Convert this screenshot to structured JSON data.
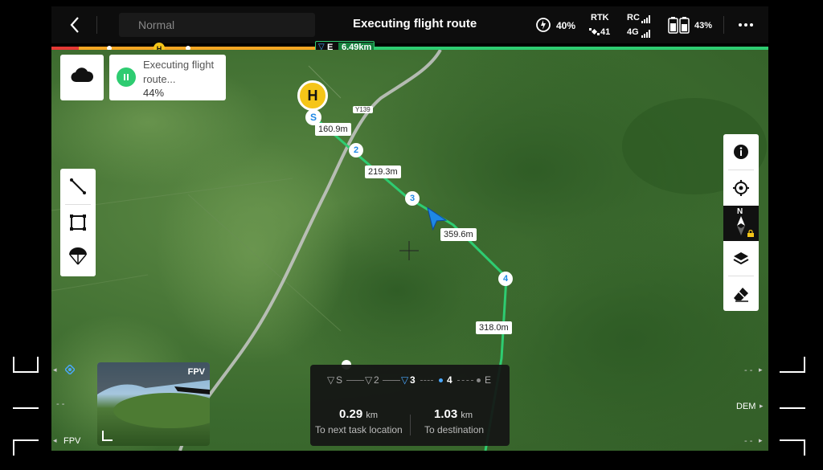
{
  "topbar": {
    "mode": "Normal",
    "title": "Executing flight route",
    "battery_drone": "40%",
    "rtk_label": "RTK",
    "rtk_sats": "41",
    "rc_label": "RC",
    "signal_4g": "4G",
    "battery_rc": "43%"
  },
  "progress": {
    "fraction": 0.37,
    "home_marker": "H",
    "end_marker": "E",
    "remaining": "6.49km"
  },
  "status": {
    "line1": "Executing flight",
    "line2": "route...",
    "percent": "44%"
  },
  "map": {
    "home_label": "H",
    "start_label": "S",
    "road_label": "Y139",
    "waypoints": [
      {
        "label": "2"
      },
      {
        "label": "3"
      },
      {
        "label": "4"
      }
    ],
    "distances": [
      "160.9m",
      "219.3m",
      "359.6m",
      "318.0m"
    ]
  },
  "fpv": {
    "label": "FPV",
    "edge_label": "FPV"
  },
  "nav": {
    "route": [
      "S",
      "2",
      "3",
      "4",
      "E"
    ],
    "next_value": "0.29",
    "next_unit": "km",
    "next_caption": "To next task location",
    "dest_value": "1.03",
    "dest_unit": "km",
    "dest_caption": "To destination"
  },
  "right_panel": {
    "compass_letter": "N"
  },
  "edge": {
    "dem": "DEM",
    "dashes": "- -"
  },
  "colors": {
    "route_green": "#2ecc71",
    "home_yellow": "#f5c518",
    "drone_blue": "#1e88e5"
  }
}
